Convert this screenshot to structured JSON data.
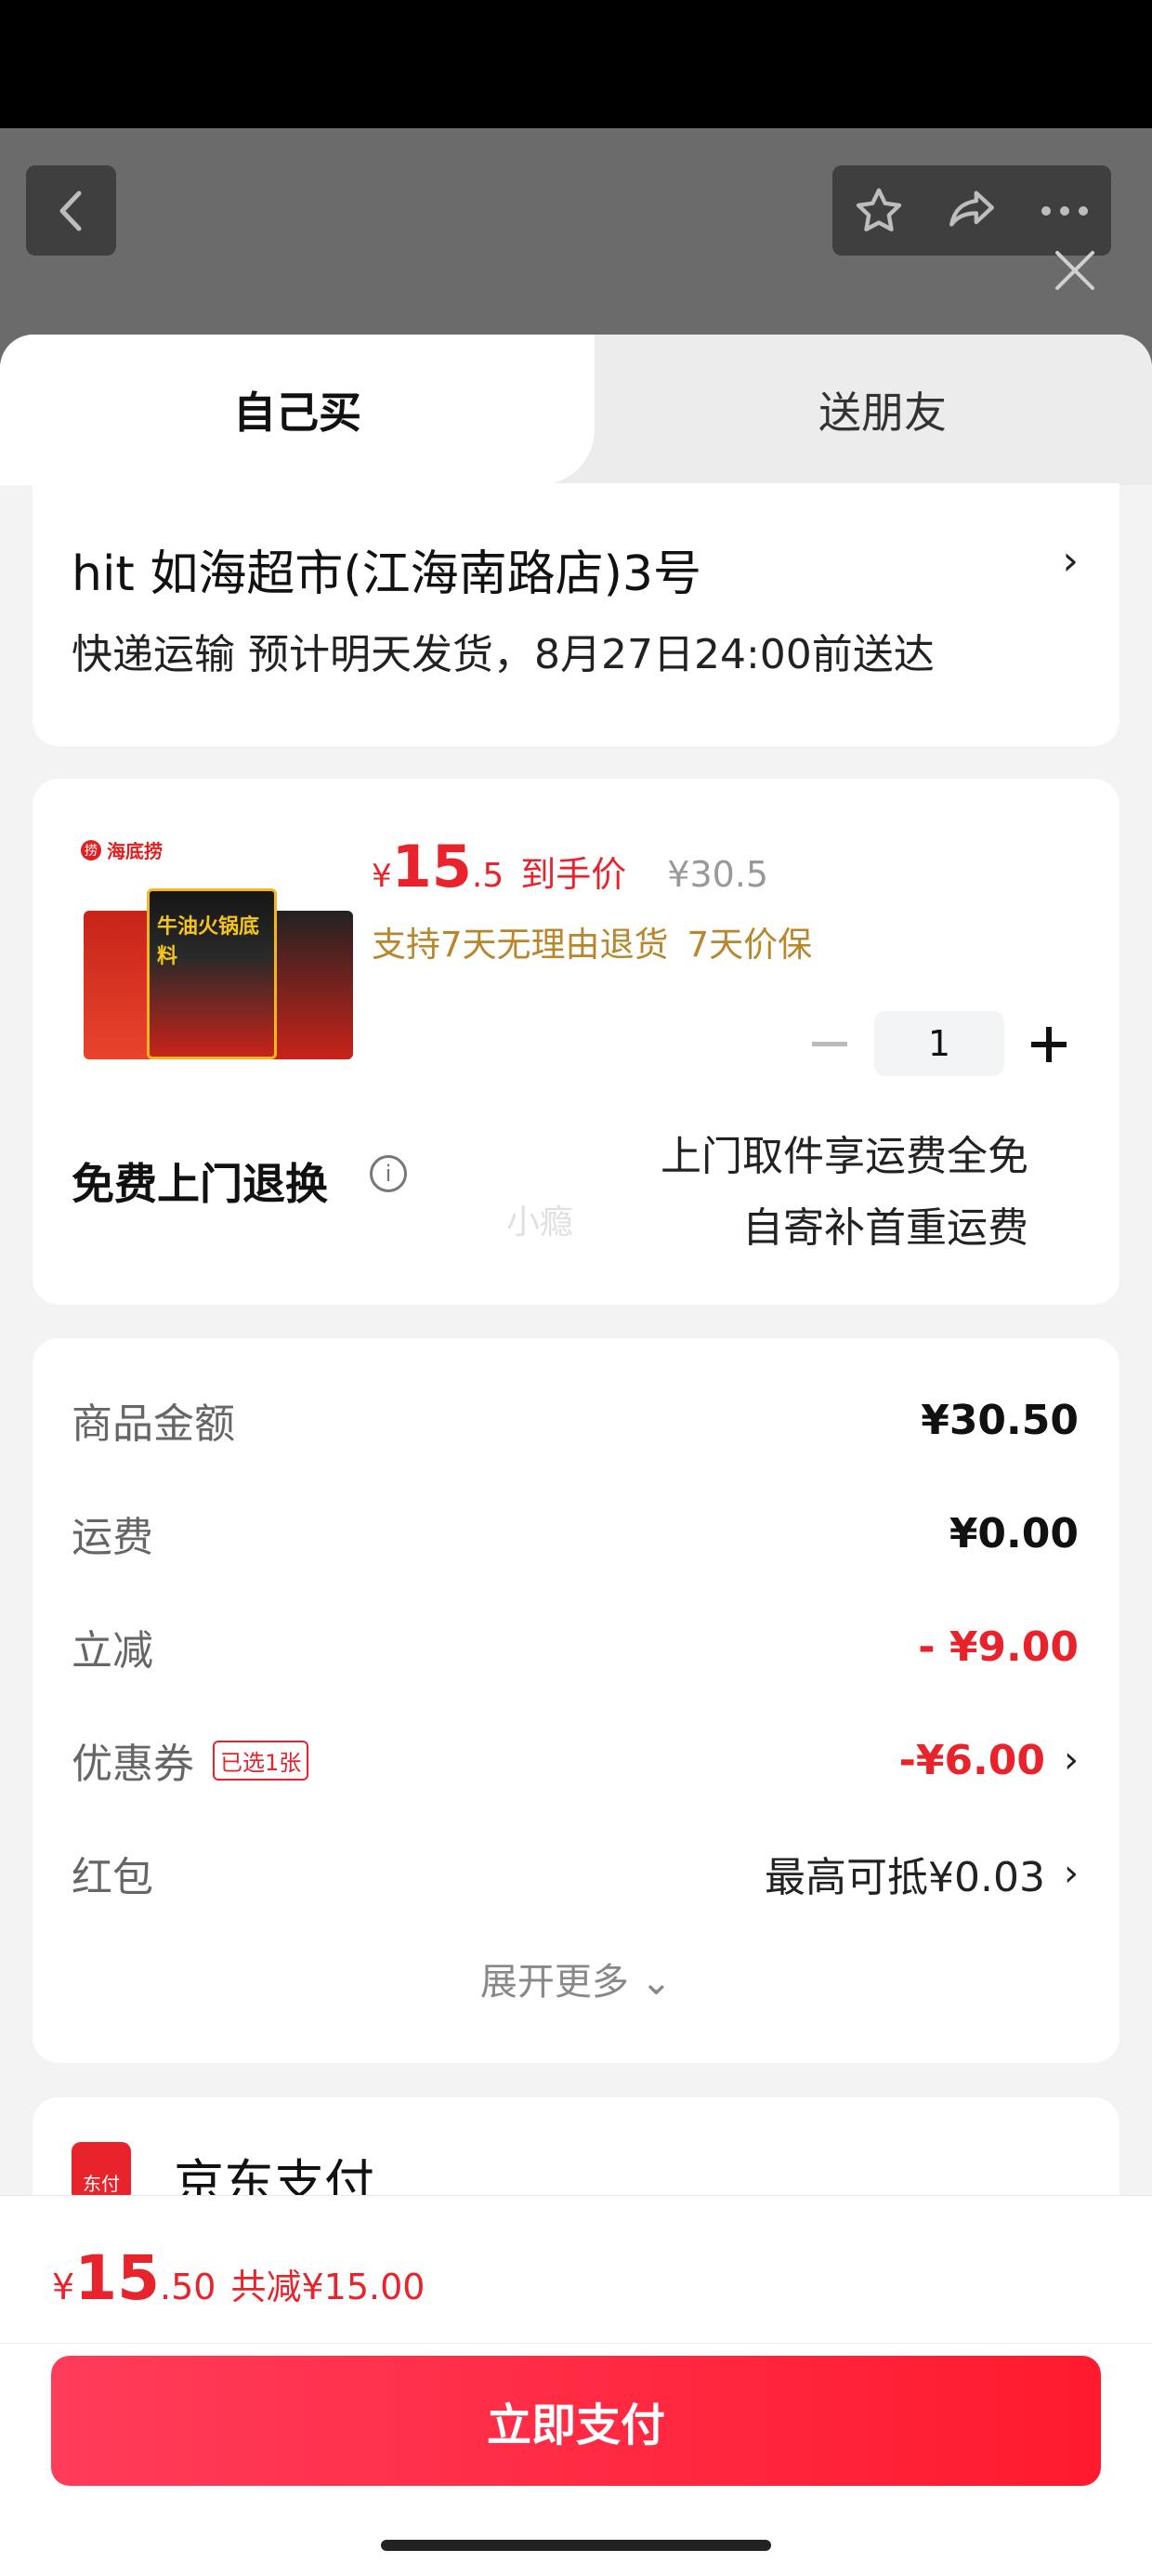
{
  "tabs": {
    "self": "自己买",
    "friend": "送朋友"
  },
  "address": {
    "title": "hit  如海超市(江海南路店)3号",
    "delivery": "快递运输 预计明天发货，8月27日24:00前送达"
  },
  "product": {
    "brand": "海底捞",
    "image_label": "牛油火锅底料",
    "price_symbol": "¥",
    "price_int": "15",
    "price_dec": ".5",
    "price_label": "到手价",
    "original_price": "¥30.5",
    "service_1": "支持7天无理由退货",
    "service_2": "7天价保",
    "quantity": "1",
    "free_return": "免费上门退换",
    "return_line1": "上门取件享运费全免",
    "return_line2": "自寄补首重运费",
    "watermark": "小瘾"
  },
  "fees": {
    "goods_label": "商品金额",
    "goods_value": "¥30.50",
    "shipping_label": "运费",
    "shipping_value": "¥0.00",
    "discount_label": "立减",
    "discount_value": "- ¥9.00",
    "coupon_label": "优惠券",
    "coupon_badge": "已选1张",
    "coupon_value": "-¥6.00",
    "redpacket_label": "红包",
    "redpacket_value": "最高可抵¥0.03",
    "expand_more": "展开更多"
  },
  "payment": {
    "method": "京东支付",
    "icon_text": "东付"
  },
  "bottom": {
    "yen": "¥",
    "total_int": "15",
    "total_dec": ".50",
    "saved": "共减¥15.00",
    "pay_button": "立即支付"
  },
  "colors": {
    "accent": "#e8232c",
    "service": "#b8862b"
  }
}
